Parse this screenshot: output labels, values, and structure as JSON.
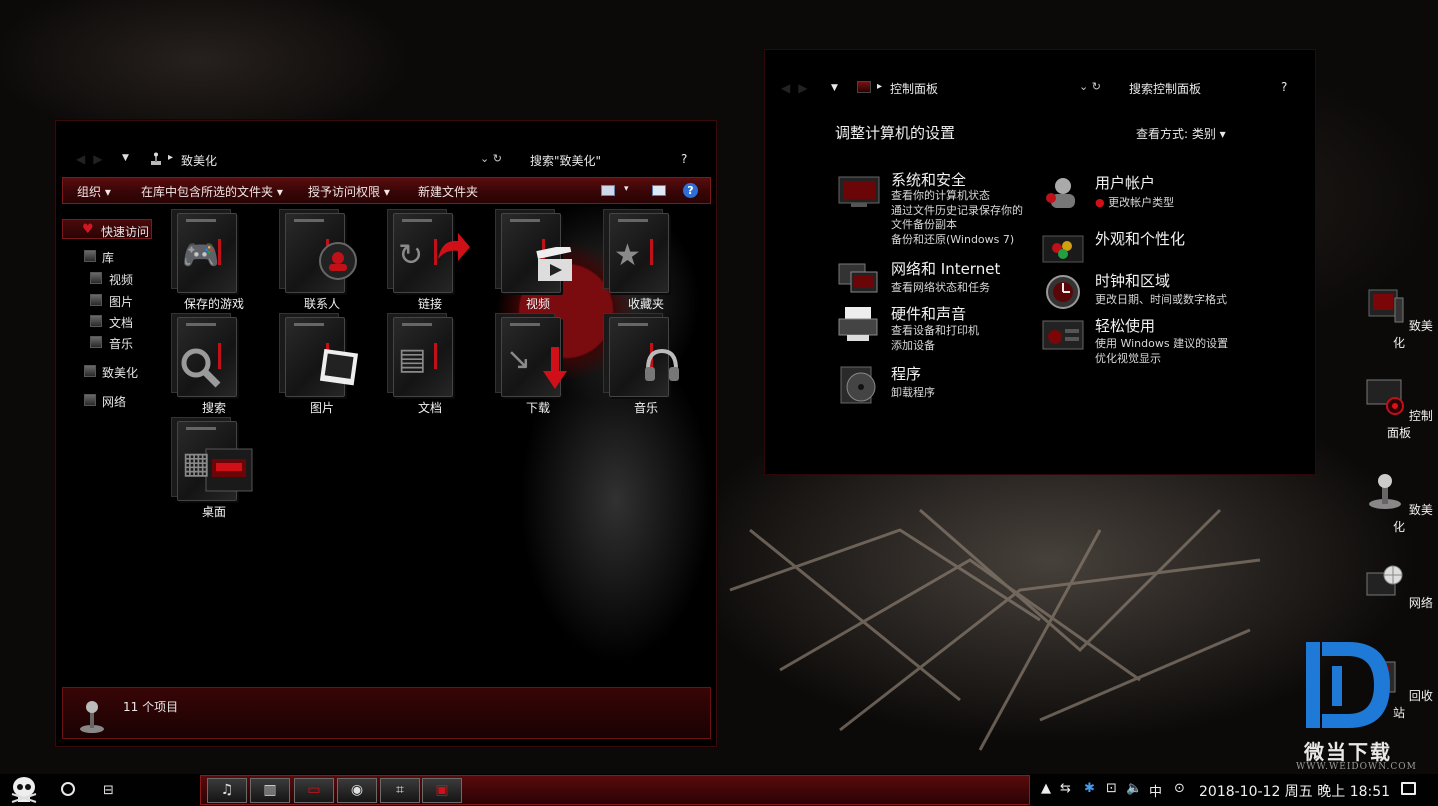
{
  "explorer": {
    "path_label": "致美化",
    "search_placeholder": "搜索\"致美化\"",
    "help": "?",
    "toolbar": {
      "organize": "组织",
      "include_in_library": "在库中包含所选的文件夹",
      "share_with": "授予访问权限",
      "new_folder": "新建文件夹"
    },
    "nav": {
      "quick_access": "快速访问",
      "library": "库",
      "videos": "视频",
      "pictures": "图片",
      "documents": "文档",
      "music": "音乐",
      "user": "致美化",
      "network": "网络"
    },
    "items": [
      "保存的游戏",
      "联系人",
      "链接",
      "视频",
      "收藏夹",
      "搜索",
      "图片",
      "文档",
      "下载",
      "音乐",
      "桌面"
    ],
    "status": "11 个项目"
  },
  "control_panel": {
    "path_label": "控制面板",
    "search_placeholder": "搜索控制面板",
    "help": "?",
    "heading": "调整计算机的设置",
    "view_by": "查看方式:  类别",
    "categories": {
      "system": {
        "title": "系统和安全",
        "lines": [
          "查看你的计算机状态",
          "通过文件历史记录保存你的",
          "文件备份副本",
          "备份和还原(Windows 7)"
        ]
      },
      "network": {
        "title": "网络和 Internet",
        "lines": [
          "查看网络状态和任务"
        ]
      },
      "hardware": {
        "title": "硬件和声音",
        "lines": [
          "查看设备和打印机",
          "添加设备"
        ]
      },
      "programs": {
        "title": "程序",
        "lines": [
          "卸载程序"
        ]
      },
      "accounts": {
        "title": "用户帐户",
        "lines": [
          "更改帐户类型"
        ]
      },
      "appearance": {
        "title": "外观和个性化",
        "lines": []
      },
      "clock": {
        "title": "时钟和区域",
        "lines": [
          "更改日期、时间或数字格式"
        ]
      },
      "ease": {
        "title": "轻松使用",
        "lines": [
          "使用 Windows 建议的设置",
          "优化视觉显示"
        ]
      }
    }
  },
  "desktop": {
    "icons": [
      "致美化",
      "控制面板",
      "致美化",
      "网络",
      "回收站"
    ]
  },
  "watermark": {
    "brand": "微当下载",
    "url": "WWW.WEIDOWN.COM"
  },
  "taskbar": {
    "tray_ime": "中",
    "clock": "2018-10-12 周五 晚上 18:51"
  },
  "colors": {
    "accent": "#6a0c0e",
    "accent_border": "#8a1a1c",
    "background": "#0c0a09"
  }
}
